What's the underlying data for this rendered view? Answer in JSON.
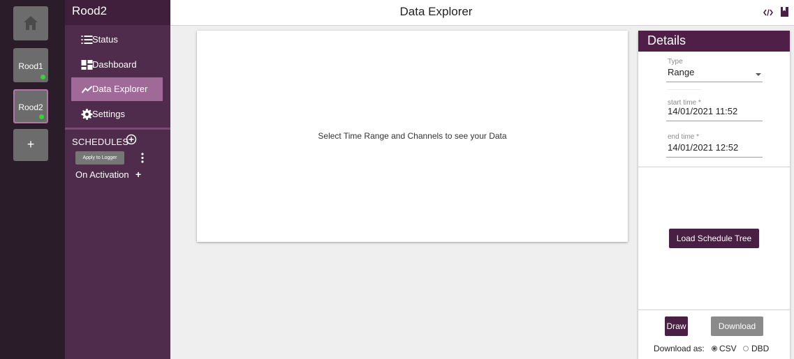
{
  "rail": {
    "devices": [
      {
        "label": "Rood1",
        "online": true
      },
      {
        "label": "Rood2",
        "online": true,
        "selected": true
      }
    ],
    "add_label": "+",
    "icons": {
      "home": "home-icon",
      "online": "status-dot-icon"
    },
    "colors": {
      "online_dot": "#39d13b",
      "selected_border": "#b575a6"
    }
  },
  "sidebar": {
    "device_name": "Rood2",
    "nav": [
      {
        "label": "Status",
        "icon": "list-icon"
      },
      {
        "label": "Dashboard",
        "icon": "dashboard-icon"
      },
      {
        "label": "Data Explorer",
        "icon": "line-chart-icon",
        "active": true
      },
      {
        "label": "Settings",
        "icon": "gear-icon"
      }
    ],
    "schedules_label": "SCHEDULES",
    "apply_label": "Apply to Logger",
    "activation_label": "On Activation",
    "activation_add": "+"
  },
  "header": {
    "title": "Data Explorer",
    "icons": [
      "code-icon",
      "book-icon"
    ]
  },
  "plot": {
    "message": "Select Time Range and Channels to see your Data"
  },
  "details": {
    "title": "Details",
    "type": {
      "label": "Type",
      "value": "Range"
    },
    "start_time": {
      "label": "start time *",
      "value": "14/01/2021 11:52"
    },
    "end_time": {
      "label": "end time *",
      "value": "14/01/2021 12:52"
    },
    "load_label": "Load Schedule Tree",
    "draw_label": "Draw",
    "download_label": "Download",
    "download_as_label": "Download as:",
    "formats": [
      {
        "label": "CSV",
        "selected": true
      },
      {
        "label": "DBD",
        "selected": false
      }
    ]
  },
  "colors": {
    "rail_bg": "#2b1c29",
    "sidebar_bg": "#4f2c4b",
    "sidebar_top": "#3f1f3c",
    "nav_active": "#a06a98",
    "accent": "#4a1f44",
    "disabled_button": "#8a8a8a"
  }
}
